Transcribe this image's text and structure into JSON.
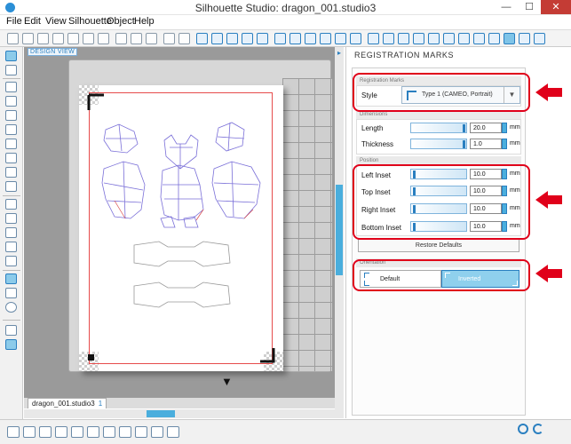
{
  "window": {
    "title": "Silhouette Studio: dragon_001.studio3",
    "minimize": "—",
    "maximize": "☐",
    "close": "✕"
  },
  "menu": [
    "File",
    "Edit",
    "View",
    "Silhouette",
    "Object",
    "Help"
  ],
  "design_view_label": "DESIGN VIEW",
  "document_tab": {
    "name": "dragon_001.studio3",
    "number": "1"
  },
  "panel": {
    "title": "REGISTRATION MARKS",
    "registration_marks_section": "Registration Marks",
    "style_label": "Style",
    "style_value": "Type 1 (CAMEO, Portrait)",
    "dimensions_section": "Dimensions",
    "length_label": "Length",
    "length_value": "20.0",
    "thickness_label": "Thickness",
    "thickness_value": "1.0",
    "position_section": "Position",
    "left_inset_label": "Left Inset",
    "left_inset_value": "10.0",
    "top_inset_label": "Top Inset",
    "top_inset_value": "10.0",
    "right_inset_label": "Right Inset",
    "right_inset_value": "10.0",
    "bottom_inset_label": "Bottom Inset",
    "bottom_inset_value": "10.0",
    "unit": "mm",
    "restore_defaults": "Restore Defaults",
    "orientation_section": "Orientation",
    "orientation_default": "Default",
    "orientation_inverted": "Inverted",
    "selected_orientation": "Inverted"
  },
  "colors": {
    "accent": "#2a7fc0",
    "selected": "#8fd0ed",
    "annotation": "#e0001a",
    "cut_line": "#e64b4b"
  }
}
